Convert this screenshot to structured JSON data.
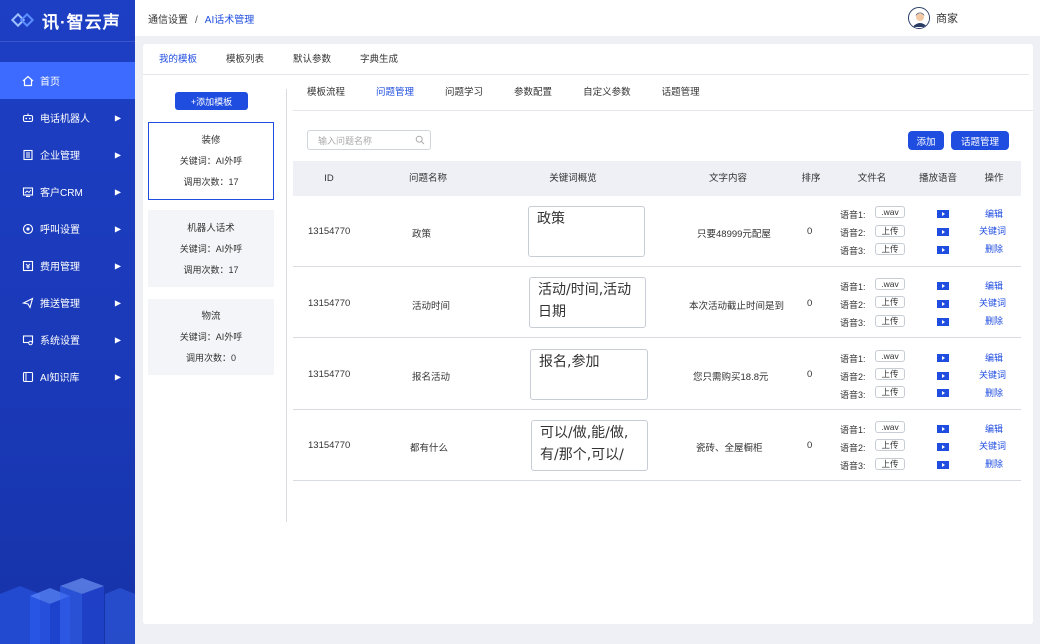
{
  "app": {
    "logo_text": "讯·智云声"
  },
  "sidebar": {
    "items": [
      {
        "label": "首页",
        "icon": "home-icon"
      },
      {
        "label": "电话机器人",
        "icon": "robot-icon"
      },
      {
        "label": "企业管理",
        "icon": "building-icon"
      },
      {
        "label": "客户CRM",
        "icon": "crm-icon"
      },
      {
        "label": "呼叫设置",
        "icon": "call-settings-icon"
      },
      {
        "label": "费用管理",
        "icon": "billing-icon"
      },
      {
        "label": "推送管理",
        "icon": "send-icon"
      },
      {
        "label": "系统设置",
        "icon": "system-settings-icon"
      },
      {
        "label": "AI知识库",
        "icon": "knowledge-base-icon"
      }
    ],
    "arrow": "▶"
  },
  "breadcrumb": {
    "parent": "通信设置",
    "separator": "/",
    "current": "AI话术管理"
  },
  "user": {
    "name": "商家"
  },
  "tabs": [
    "我的模板",
    "模板列表",
    "默认参数",
    "字典生成"
  ],
  "templates": {
    "add_label": "+添加模板",
    "cards": [
      {
        "title": "装修",
        "keyword": "关键词：AI外呼",
        "usage": "调用次数：17"
      },
      {
        "title": "机器人话术",
        "keyword": "关键词：AI外呼",
        "usage": "调用次数：17"
      },
      {
        "title": "物流",
        "keyword": "关键词：AI外呼",
        "usage": "调用次数：0"
      }
    ]
  },
  "subtabs": [
    "模板流程",
    "问题管理",
    "问题学习",
    "参数配置",
    "自定义参数",
    "话题管理"
  ],
  "search": {
    "placeholder": "输入问题名称"
  },
  "buttons": {
    "add": "添加",
    "topic": "话题管理"
  },
  "table": {
    "headers": [
      "ID",
      "问题名称",
      "关键词概览",
      "文字内容",
      "排序",
      "文件名",
      "播放语音",
      "操作"
    ],
    "rows": [
      {
        "id": "13154770",
        "name": "政策",
        "keywords": "政策",
        "text": "只要48999元配屋",
        "order": "0"
      },
      {
        "id": "13154770",
        "name": "活动时间",
        "keywords": "活动/时间,活动日期",
        "text": "本次活动截止时间是到",
        "order": "0"
      },
      {
        "id": "13154770",
        "name": "报名活动",
        "keywords": "报名,参加",
        "text": "您只需购买18.8元",
        "order": "0"
      },
      {
        "id": "13154770",
        "name": "都有什么",
        "keywords": "可以/做,能/做,有/那个,可以/",
        "text": "瓷砖、全屋橱柜",
        "order": "0"
      }
    ],
    "voice_labels": [
      "语音1:",
      "语音2:",
      "语音3:"
    ],
    "voice_buttons": [
      ".wav",
      "上传",
      "上传"
    ],
    "ops": [
      "编辑",
      "关键词",
      "删除"
    ]
  },
  "colors": {
    "primary": "#1f4de0",
    "sidebar": "#1d3fc4",
    "sidebar_active": "#3d6bff"
  }
}
